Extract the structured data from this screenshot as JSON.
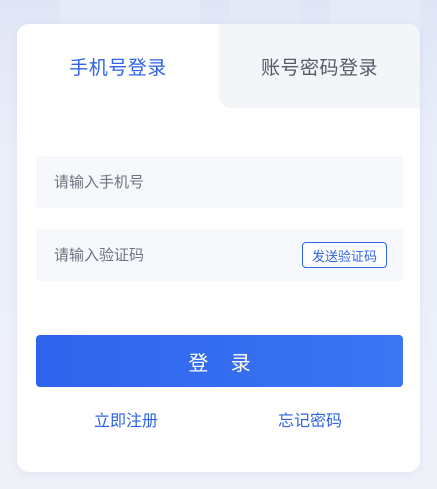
{
  "tabs": {
    "phone_login": "手机号登录",
    "account_login": "账号密码登录"
  },
  "form": {
    "phone_placeholder": "请输入手机号",
    "code_placeholder": "请输入验证码",
    "send_code_label": "发送验证码",
    "login_label": "登 录"
  },
  "links": {
    "register": "立即注册",
    "forgot_password": "忘记密码"
  },
  "colors": {
    "accent": "#2e63e6",
    "button": "#2f63ec",
    "field_bg": "#f6f8fb",
    "inactive_tab_bg": "#f3f5f9"
  }
}
